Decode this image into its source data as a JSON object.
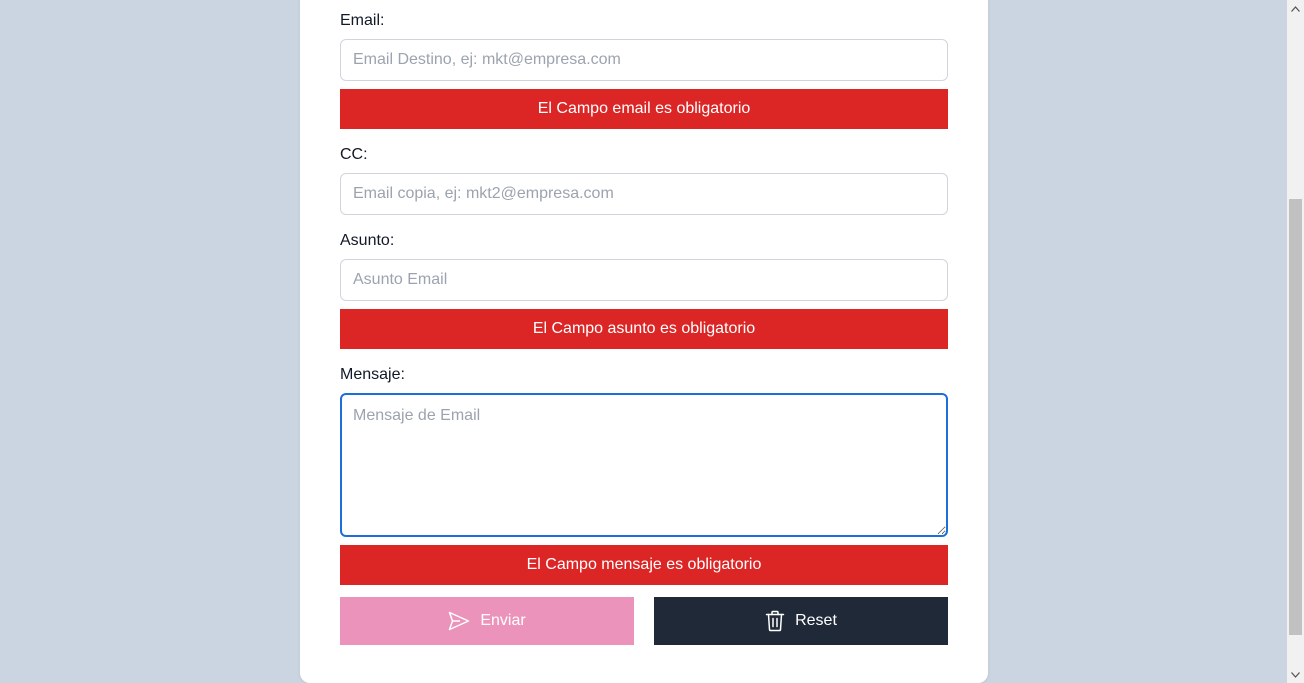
{
  "form": {
    "email": {
      "label": "Email:",
      "placeholder": "Email Destino, ej: mkt@empresa.com",
      "value": "",
      "error": "El Campo email es obligatorio"
    },
    "cc": {
      "label": "CC:",
      "placeholder": "Email copia, ej: mkt2@empresa.com",
      "value": ""
    },
    "subject": {
      "label": "Asunto:",
      "placeholder": "Asunto Email",
      "value": "",
      "error": "El Campo asunto es obligatorio"
    },
    "message": {
      "label": "Mensaje:",
      "placeholder": "Mensaje de Email",
      "value": "",
      "error": "El Campo mensaje es obligatorio"
    }
  },
  "actions": {
    "send_label": "Enviar",
    "send_icon": "paper-plane-icon",
    "reset_label": "Reset",
    "reset_icon": "trash-icon"
  },
  "colors": {
    "page_background": "#cbd5e1",
    "error": "#dc2626",
    "send_button": "#ec93bb",
    "reset_button": "#1f2937",
    "focus_border": "#1d6ed8"
  }
}
